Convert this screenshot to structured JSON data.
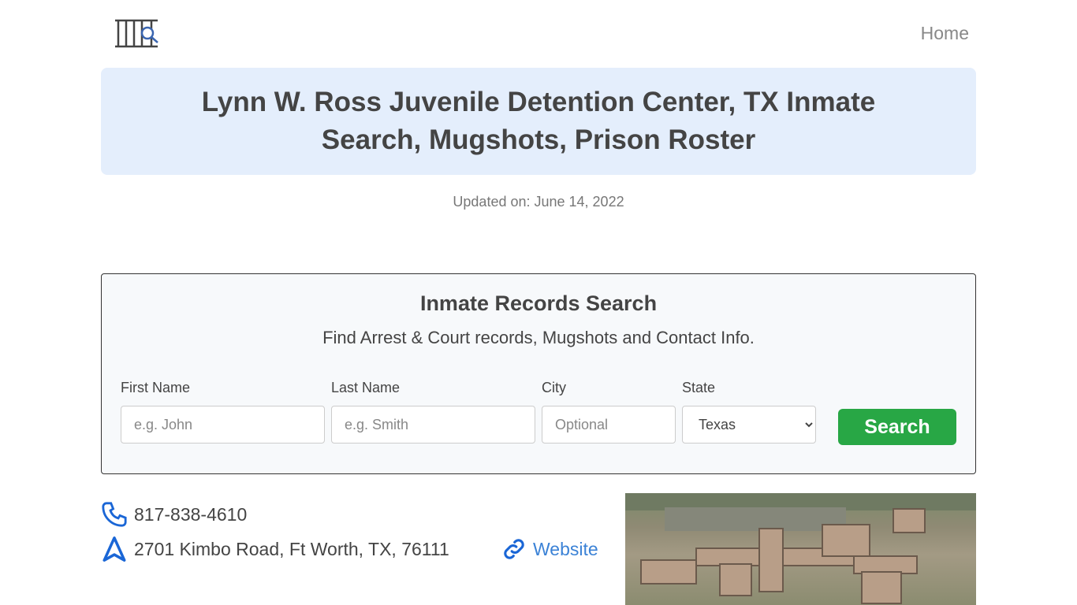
{
  "nav": {
    "home_label": "Home"
  },
  "header": {
    "title": "Lynn W. Ross Juvenile Detention Center, TX Inmate Search, Mugshots, Prison Roster",
    "updated": "Updated on: June 14, 2022"
  },
  "search": {
    "title": "Inmate Records Search",
    "subtitle": "Find Arrest & Court records, Mugshots and Contact Info.",
    "first_name": {
      "label": "First Name",
      "placeholder": "e.g. John"
    },
    "last_name": {
      "label": "Last Name",
      "placeholder": "e.g. Smith"
    },
    "city": {
      "label": "City",
      "placeholder": "Optional"
    },
    "state": {
      "label": "State",
      "value": "Texas"
    },
    "button_label": "Search"
  },
  "contact": {
    "phone": "817-838-4610",
    "address": "2701 Kimbo Road, Ft Worth, TX, 76111",
    "website_label": "Website"
  },
  "colors": {
    "accent": "#1a66d6",
    "button": "#28a745",
    "banner": "#e4eefc"
  }
}
